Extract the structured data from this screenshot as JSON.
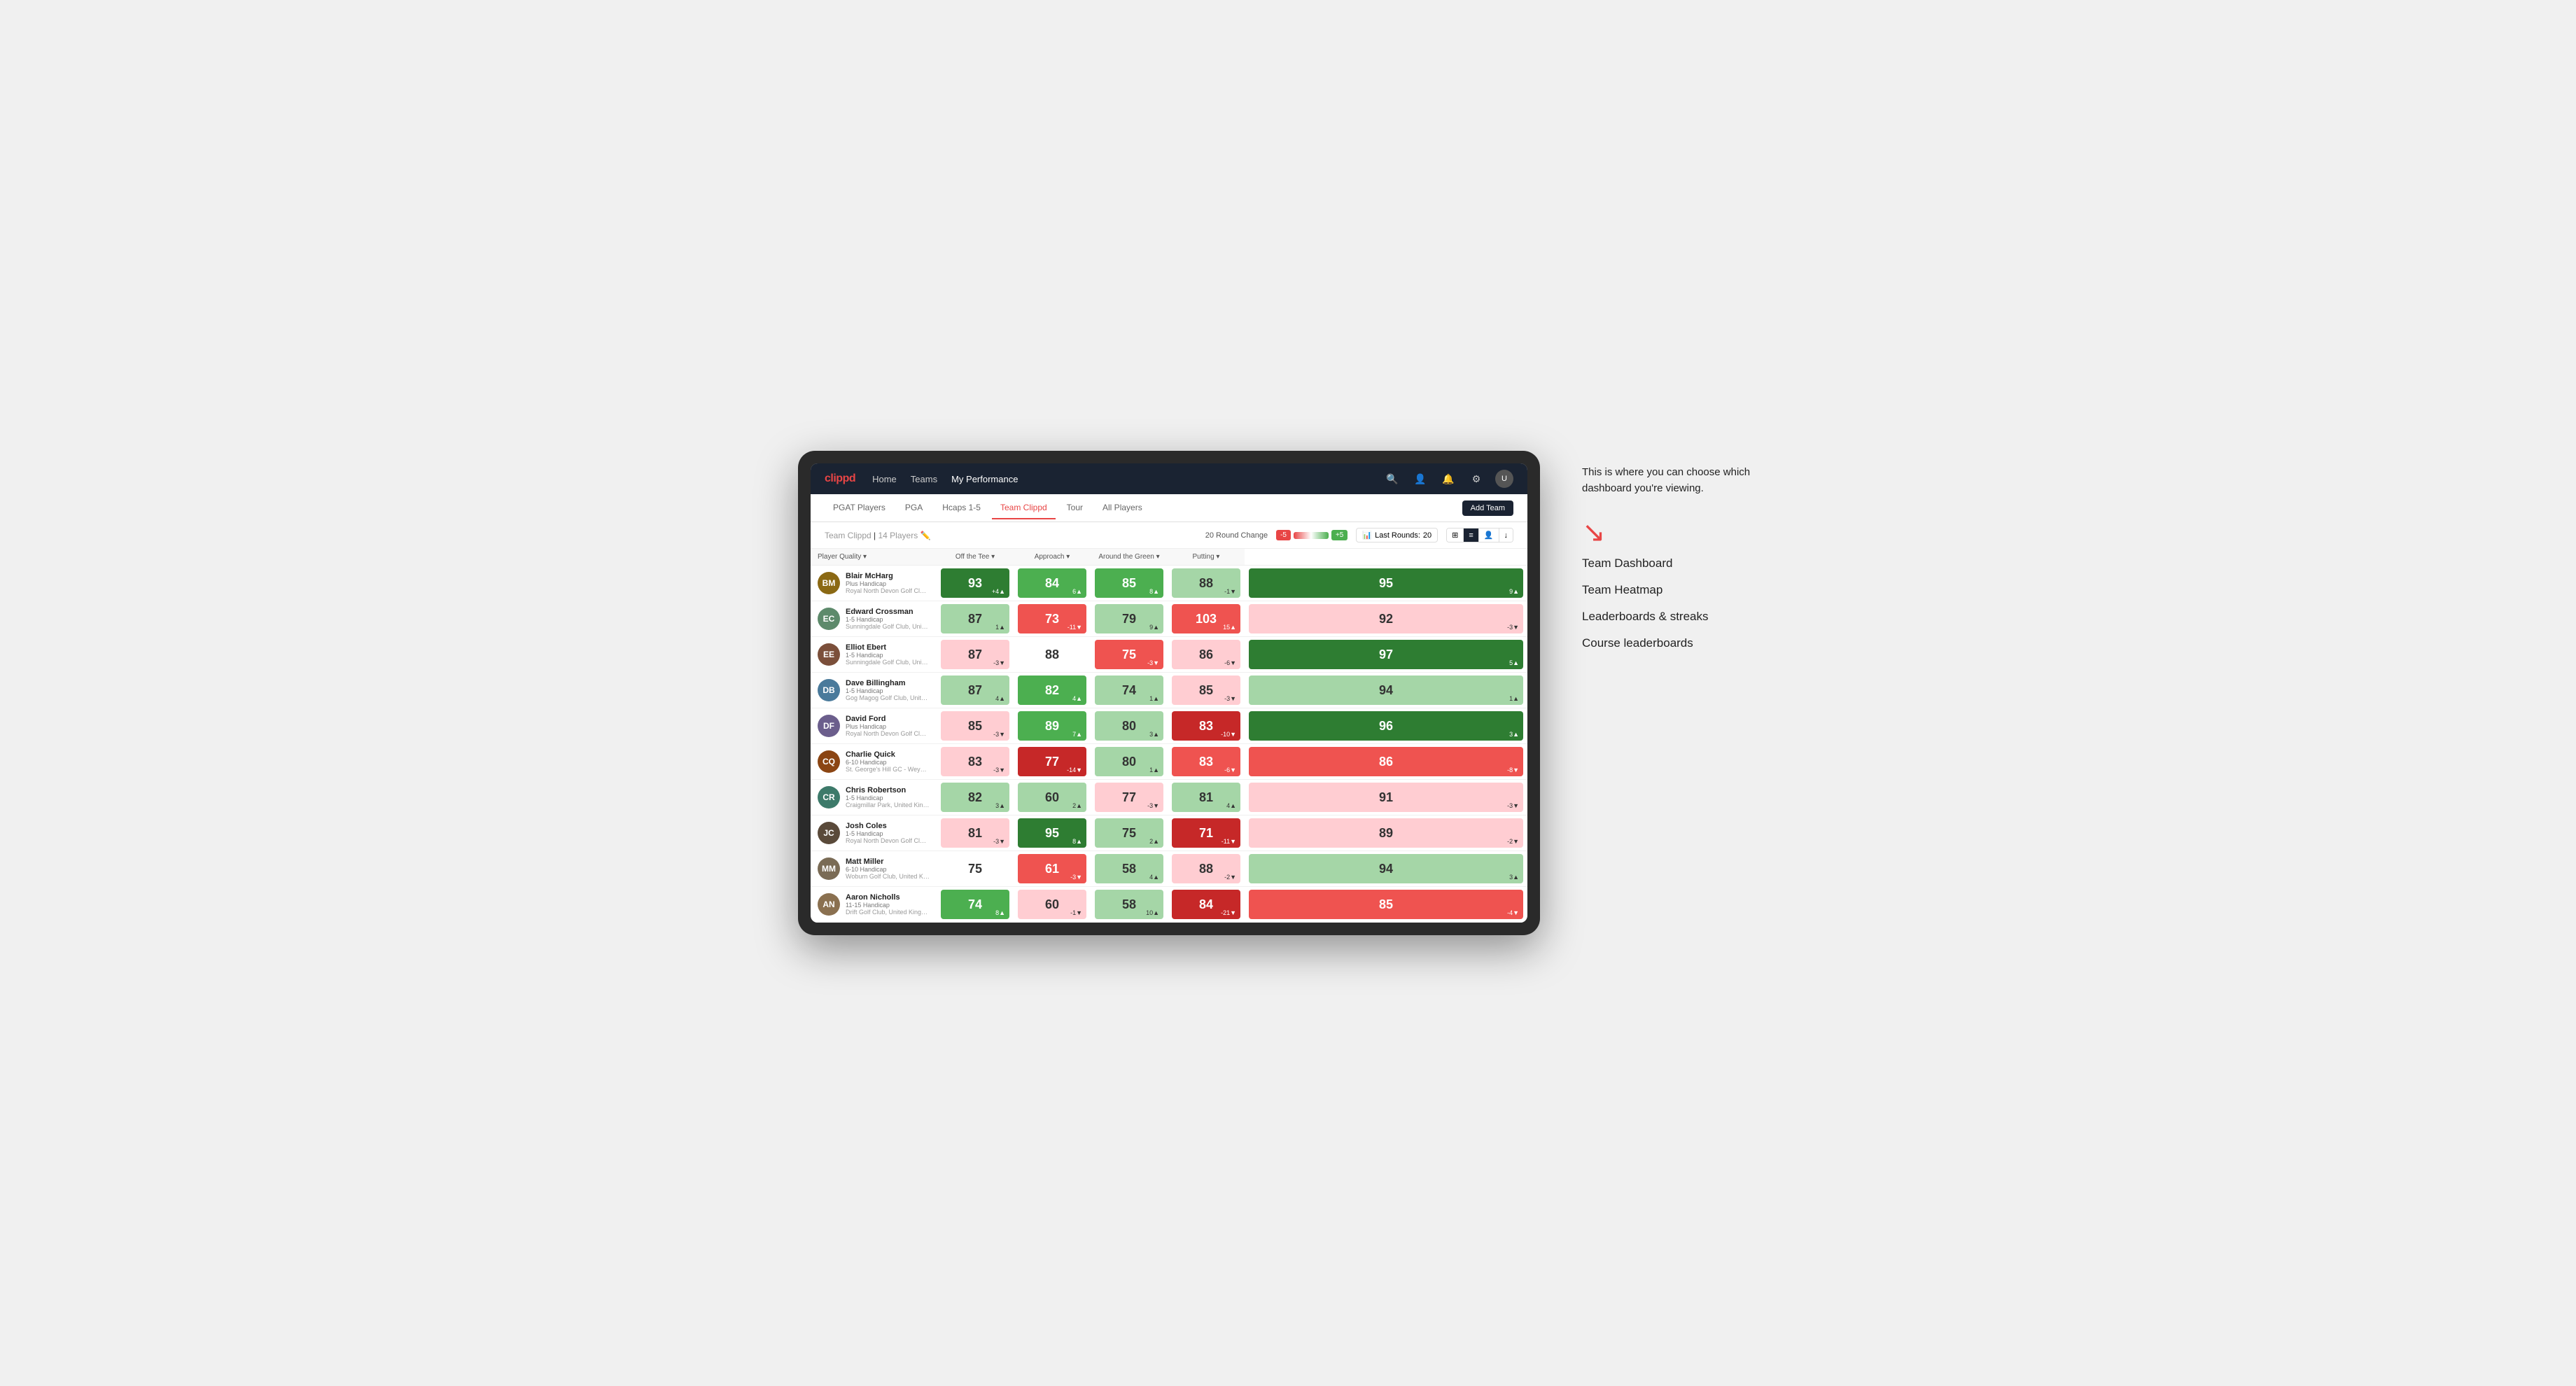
{
  "annotation": {
    "intro_text": "This is where you can choose which dashboard you're viewing.",
    "menu_items": [
      "Team Dashboard",
      "Team Heatmap",
      "Leaderboards & streaks",
      "Course leaderboards"
    ]
  },
  "nav": {
    "logo": "clippd",
    "links": [
      "Home",
      "Teams",
      "My Performance"
    ],
    "active_link": "My Performance"
  },
  "sub_nav": {
    "tabs": [
      "PGAT Players",
      "PGA",
      "Hcaps 1-5",
      "Team Clippd",
      "Tour",
      "All Players"
    ],
    "active_tab": "Team Clippd",
    "add_team": "Add Team"
  },
  "team_header": {
    "title": "Team Clippd",
    "player_count": "14 Players",
    "round_change_label": "20 Round Change",
    "pill_neg": "-5",
    "pill_pos": "+5",
    "last_rounds_label": "Last Rounds:",
    "last_rounds_value": "20"
  },
  "table": {
    "columns": {
      "player": "Player Quality",
      "off_tee": "Off the Tee",
      "approach": "Approach",
      "around_green": "Around the Green",
      "putting": "Putting"
    },
    "players": [
      {
        "name": "Blair McHarg",
        "handicap": "Plus Handicap",
        "club": "Royal North Devon Golf Club, United Kingdom",
        "initials": "BM",
        "color": "#8B6914",
        "scores": {
          "quality": {
            "val": 93,
            "delta": "+4",
            "dir": "up",
            "bg": "bg-green-dark"
          },
          "off_tee": {
            "val": 84,
            "delta": "6",
            "dir": "up",
            "bg": "bg-green-mid"
          },
          "approach": {
            "val": 85,
            "delta": "8",
            "dir": "up",
            "bg": "bg-green-mid"
          },
          "around": {
            "val": 88,
            "delta": "-1",
            "dir": "down",
            "bg": "bg-green-light"
          },
          "putting": {
            "val": 95,
            "delta": "9",
            "dir": "up",
            "bg": "bg-green-dark"
          }
        }
      },
      {
        "name": "Edward Crossman",
        "handicap": "1-5 Handicap",
        "club": "Sunningdale Golf Club, United Kingdom",
        "initials": "EC",
        "color": "#5D8A6B",
        "scores": {
          "quality": {
            "val": 87,
            "delta": "1",
            "dir": "up",
            "bg": "bg-green-light"
          },
          "off_tee": {
            "val": 73,
            "delta": "-11",
            "dir": "down",
            "bg": "bg-red-mid"
          },
          "approach": {
            "val": 79,
            "delta": "9",
            "dir": "up",
            "bg": "bg-green-light"
          },
          "around": {
            "val": 103,
            "delta": "15",
            "dir": "up",
            "bg": "bg-red-mid"
          },
          "putting": {
            "val": 92,
            "delta": "-3",
            "dir": "down",
            "bg": "bg-red-light"
          }
        }
      },
      {
        "name": "Elliot Ebert",
        "handicap": "1-5 Handicap",
        "club": "Sunningdale Golf Club, United Kingdom",
        "initials": "EE",
        "color": "#7B4F3A",
        "scores": {
          "quality": {
            "val": 87,
            "delta": "-3",
            "dir": "down",
            "bg": "bg-red-light"
          },
          "off_tee": {
            "val": 88,
            "delta": "",
            "dir": "",
            "bg": "bg-white"
          },
          "approach": {
            "val": 75,
            "delta": "-3",
            "dir": "down",
            "bg": "bg-red-mid"
          },
          "around": {
            "val": 86,
            "delta": "-6",
            "dir": "down",
            "bg": "bg-red-light"
          },
          "putting": {
            "val": 97,
            "delta": "5",
            "dir": "up",
            "bg": "bg-green-dark"
          }
        }
      },
      {
        "name": "Dave Billingham",
        "handicap": "1-5 Handicap",
        "club": "Gog Magog Golf Club, United Kingdom",
        "initials": "DB",
        "color": "#4A7A9B",
        "scores": {
          "quality": {
            "val": 87,
            "delta": "4",
            "dir": "up",
            "bg": "bg-green-light"
          },
          "off_tee": {
            "val": 82,
            "delta": "4",
            "dir": "up",
            "bg": "bg-green-mid"
          },
          "approach": {
            "val": 74,
            "delta": "1",
            "dir": "up",
            "bg": "bg-green-light"
          },
          "around": {
            "val": 85,
            "delta": "-3",
            "dir": "down",
            "bg": "bg-red-light"
          },
          "putting": {
            "val": 94,
            "delta": "1",
            "dir": "up",
            "bg": "bg-green-light"
          }
        }
      },
      {
        "name": "David Ford",
        "handicap": "Plus Handicap",
        "club": "Royal North Devon Golf Club, United Kingdom",
        "initials": "DF",
        "color": "#6B5E8C",
        "scores": {
          "quality": {
            "val": 85,
            "delta": "-3",
            "dir": "down",
            "bg": "bg-red-light"
          },
          "off_tee": {
            "val": 89,
            "delta": "7",
            "dir": "up",
            "bg": "bg-green-mid"
          },
          "approach": {
            "val": 80,
            "delta": "3",
            "dir": "up",
            "bg": "bg-green-light"
          },
          "around": {
            "val": 83,
            "delta": "-10",
            "dir": "down",
            "bg": "bg-red-dark"
          },
          "putting": {
            "val": 96,
            "delta": "3",
            "dir": "up",
            "bg": "bg-green-dark"
          }
        }
      },
      {
        "name": "Charlie Quick",
        "handicap": "6-10 Handicap",
        "club": "St. George's Hill GC - Weybridge, Surrey, Uni...",
        "initials": "CQ",
        "color": "#8B4513",
        "scores": {
          "quality": {
            "val": 83,
            "delta": "-3",
            "dir": "down",
            "bg": "bg-red-light"
          },
          "off_tee": {
            "val": 77,
            "delta": "-14",
            "dir": "down",
            "bg": "bg-red-dark"
          },
          "approach": {
            "val": 80,
            "delta": "1",
            "dir": "up",
            "bg": "bg-green-light"
          },
          "around": {
            "val": 83,
            "delta": "-6",
            "dir": "down",
            "bg": "bg-red-mid"
          },
          "putting": {
            "val": 86,
            "delta": "-8",
            "dir": "down",
            "bg": "bg-red-mid"
          }
        }
      },
      {
        "name": "Chris Robertson",
        "handicap": "1-5 Handicap",
        "club": "Craigmillar Park, United Kingdom",
        "initials": "CR",
        "color": "#3D7A6A",
        "scores": {
          "quality": {
            "val": 82,
            "delta": "3",
            "dir": "up",
            "bg": "bg-green-light"
          },
          "off_tee": {
            "val": 60,
            "delta": "2",
            "dir": "up",
            "bg": "bg-green-light"
          },
          "approach": {
            "val": 77,
            "delta": "-3",
            "dir": "down",
            "bg": "bg-red-light"
          },
          "around": {
            "val": 81,
            "delta": "4",
            "dir": "up",
            "bg": "bg-green-light"
          },
          "putting": {
            "val": 91,
            "delta": "-3",
            "dir": "down",
            "bg": "bg-red-light"
          }
        }
      },
      {
        "name": "Josh Coles",
        "handicap": "1-5 Handicap",
        "club": "Royal North Devon Golf Club, United Kingdom",
        "initials": "JC",
        "color": "#5A4A3A",
        "scores": {
          "quality": {
            "val": 81,
            "delta": "-3",
            "dir": "down",
            "bg": "bg-red-light"
          },
          "off_tee": {
            "val": 95,
            "delta": "8",
            "dir": "up",
            "bg": "bg-green-dark"
          },
          "approach": {
            "val": 75,
            "delta": "2",
            "dir": "up",
            "bg": "bg-green-light"
          },
          "around": {
            "val": 71,
            "delta": "-11",
            "dir": "down",
            "bg": "bg-red-dark"
          },
          "putting": {
            "val": 89,
            "delta": "-2",
            "dir": "down",
            "bg": "bg-red-light"
          }
        }
      },
      {
        "name": "Matt Miller",
        "handicap": "6-10 Handicap",
        "club": "Woburn Golf Club, United Kingdom",
        "initials": "MM",
        "color": "#7A6B55",
        "scores": {
          "quality": {
            "val": 75,
            "delta": "",
            "dir": "",
            "bg": "bg-white"
          },
          "off_tee": {
            "val": 61,
            "delta": "-3",
            "dir": "down",
            "bg": "bg-red-mid"
          },
          "approach": {
            "val": 58,
            "delta": "4",
            "dir": "up",
            "bg": "bg-green-light"
          },
          "around": {
            "val": 88,
            "delta": "-2",
            "dir": "down",
            "bg": "bg-red-light"
          },
          "putting": {
            "val": 94,
            "delta": "3",
            "dir": "up",
            "bg": "bg-green-light"
          }
        }
      },
      {
        "name": "Aaron Nicholls",
        "handicap": "11-15 Handicap",
        "club": "Drift Golf Club, United Kingdom",
        "initials": "AN",
        "color": "#8A7050",
        "scores": {
          "quality": {
            "val": 74,
            "delta": "8",
            "dir": "up",
            "bg": "bg-green-mid"
          },
          "off_tee": {
            "val": 60,
            "delta": "-1",
            "dir": "down",
            "bg": "bg-red-light"
          },
          "approach": {
            "val": 58,
            "delta": "10",
            "dir": "up",
            "bg": "bg-green-light"
          },
          "around": {
            "val": 84,
            "delta": "-21",
            "dir": "down",
            "bg": "bg-red-dark"
          },
          "putting": {
            "val": 85,
            "delta": "-4",
            "dir": "down",
            "bg": "bg-red-mid"
          }
        }
      }
    ]
  }
}
